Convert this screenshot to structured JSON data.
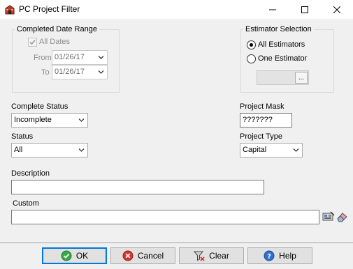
{
  "window": {
    "title": "PC Project Filter"
  },
  "date_range": {
    "legend": "Completed Date Range",
    "all_dates_label": "All Dates",
    "all_dates_checked": true,
    "from_label": "From",
    "from_value": "01/26/17",
    "to_label": "To",
    "to_value": "01/26/17"
  },
  "estimator": {
    "legend": "Estimator Selection",
    "all_label": "All Estimators",
    "one_label": "One Estimator",
    "selected": "all",
    "ellipsis": "..."
  },
  "complete_status": {
    "label": "Complete Status",
    "value": "Incomplete"
  },
  "status": {
    "label": "Status",
    "value": "All"
  },
  "project_mask": {
    "label": "Project Mask",
    "value": "???????"
  },
  "project_type": {
    "label": "Project Type",
    "value": "Capital"
  },
  "description": {
    "label": "Description",
    "value": ""
  },
  "custom": {
    "label": "Custom",
    "value": ""
  },
  "buttons": {
    "ok": "OK",
    "cancel": "Cancel",
    "clear": "Clear",
    "help": "Help"
  },
  "colors": {
    "ok_green": "#3aa845",
    "cancel_red": "#d9352b",
    "help_blue": "#2f6fcf",
    "title_icon_red": "#c0392b",
    "focus_border": "#0078d7"
  }
}
